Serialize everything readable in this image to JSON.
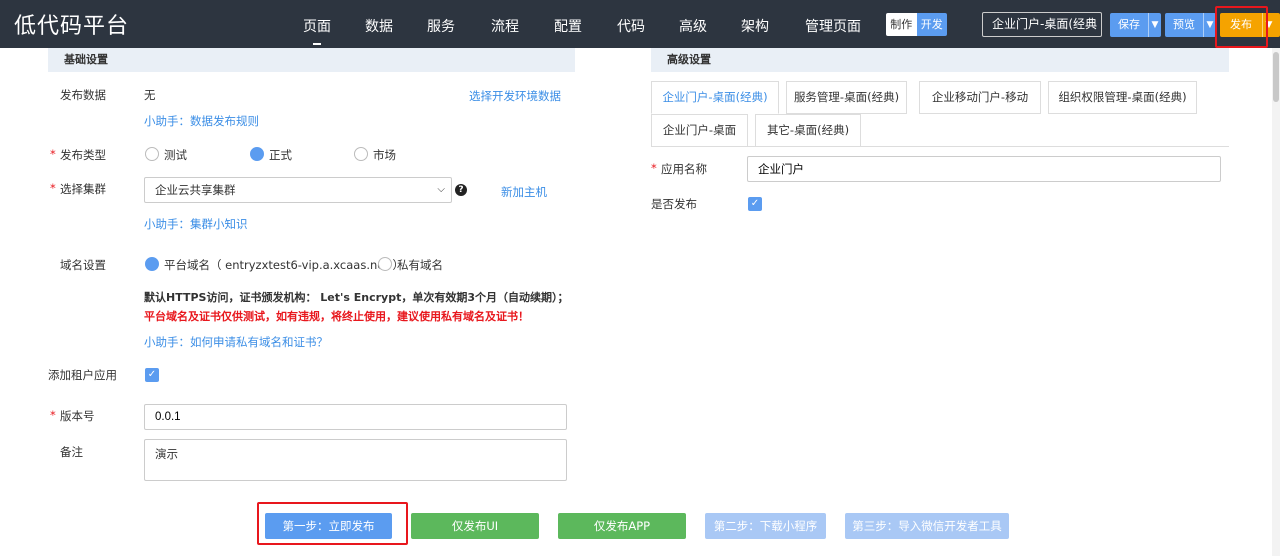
{
  "app": {
    "title": "低代码平台"
  },
  "nav": [
    "页面",
    "数据",
    "服务",
    "流程",
    "配置",
    "代码",
    "高级",
    "架构",
    "管理页面"
  ],
  "mode": {
    "make": "制作",
    "dev": "开发"
  },
  "app_select": {
    "value": "企业门户-桌面(经典"
  },
  "toolbar": {
    "save": "保存",
    "preview": "预览",
    "publish": "发布"
  },
  "basic": {
    "title": "基础设置",
    "publish_data_label": "发布数据",
    "publish_data_value": "无",
    "select_env_link": "选择开发环境数据",
    "helper_rules": "小助手：数据发布规则",
    "type_label": "发布类型",
    "type_options": [
      "测试",
      "正式",
      "市场"
    ],
    "cluster_label": "选择集群",
    "cluster_value": "企业云共享集群",
    "add_host": "新加主机",
    "helper_cluster": "小助手：集群小知识",
    "domain_label": "域名设置",
    "domain_platform": "平台域名（ entryzxtest6-vip.a.xcaas.net ）",
    "domain_private": "私有域名",
    "domain_note": "默认HTTPS访问，证书颁发机构： Let's Encrypt，单次有效期3个月（自动续期）；",
    "domain_warning": "平台域名及证书仅供测试，如有违规，将终止使用，建议使用私有域名及证书！",
    "helper_domain": "小助手：如何申请私有域名和证书？",
    "tenant_label": "添加租户应用",
    "version_label": "版本号",
    "version_value": "0.0.1",
    "remark_label": "备注",
    "remark_value": "演示"
  },
  "actions": [
    "第一步：立即发布",
    "仅发布UI",
    "仅发布APP",
    "第二步：下载小程序",
    "第三步：导入微信开发者工具"
  ],
  "advanced": {
    "title": "高级设置",
    "tabs_row1": [
      "企业门户-桌面(经典)",
      "服务管理-桌面(经典)",
      "企业移动门户-移动",
      "组织权限管理-桌面(经典)"
    ],
    "tabs_row2": [
      "企业门户-桌面",
      "其它-桌面(经典)"
    ],
    "app_name_label": "应用名称",
    "app_name_value": "企业门户",
    "is_publish_label": "是否发布"
  }
}
